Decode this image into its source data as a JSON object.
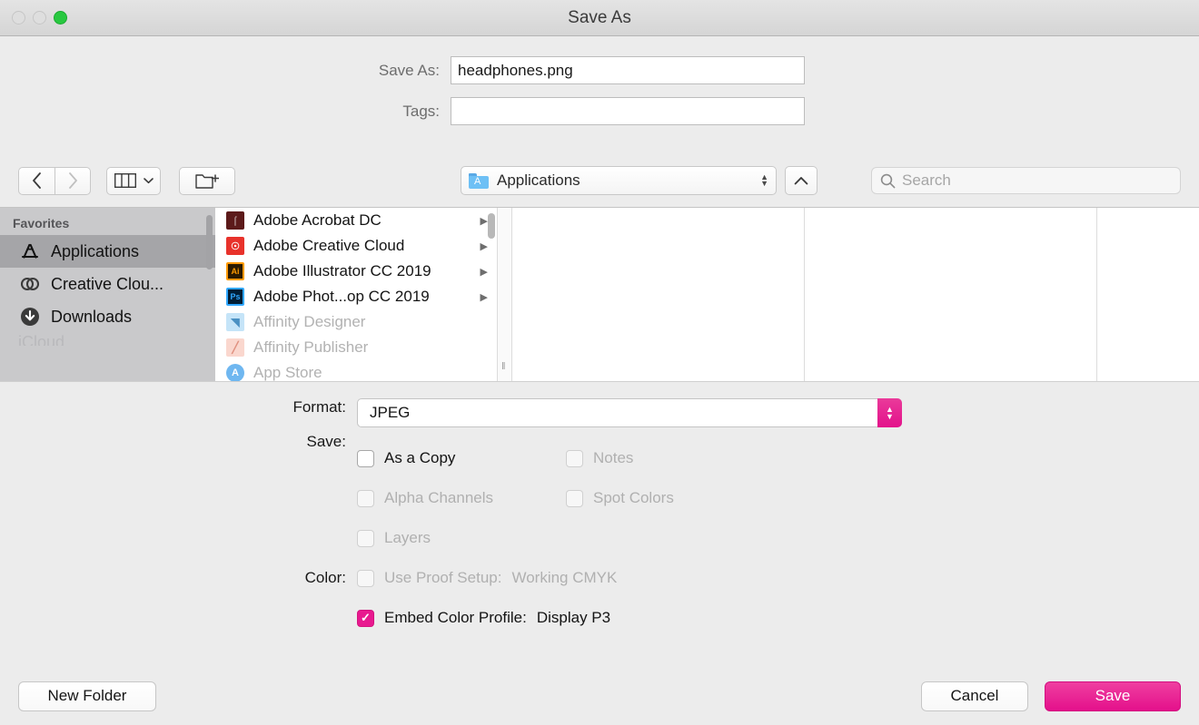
{
  "window": {
    "title": "Save As",
    "traffic_lights": [
      {
        "name": "close",
        "state": "disabled"
      },
      {
        "name": "minimize",
        "state": "disabled"
      },
      {
        "name": "zoom",
        "state": "enabled"
      }
    ]
  },
  "form": {
    "save_as_label": "Save As:",
    "save_as_value": "headphones.png",
    "tags_label": "Tags:",
    "tags_value": "",
    "tags_placeholder": ""
  },
  "toolbar": {
    "back_icon": "chevron-left-icon",
    "forward_icon": "chevron-right-icon",
    "view_icon": "column-view-icon",
    "view_chevron": "chevron-down-icon",
    "new_folder_icon": "new-folder-icon",
    "path_label": "Applications",
    "path_icon": "applications-folder-icon",
    "up_icon": "chevron-up-icon",
    "search_placeholder": "Search",
    "search_value": "",
    "search_icon": "search-icon"
  },
  "sidebar": {
    "header": "Favorites",
    "items": [
      {
        "label": "Applications",
        "icon": "applications-icon",
        "selected": true
      },
      {
        "label": "Creative Clou...",
        "icon": "creative-cloud-icon",
        "selected": false
      },
      {
        "label": "Downloads",
        "icon": "downloads-icon",
        "selected": false
      }
    ],
    "cutoff_label": "iCloud"
  },
  "file_list": [
    {
      "name": "Adobe Acrobat DC",
      "icon": "acrobat-icon",
      "icon_color": "#5c1a1a",
      "glyph": "↯",
      "has_disclosure": true,
      "dimmed": false
    },
    {
      "name": "Adobe Creative Cloud",
      "icon": "creative-cloud-folder-icon",
      "icon_color": "#e8322b",
      "glyph": "∞",
      "has_disclosure": true,
      "dimmed": false
    },
    {
      "name": "Adobe Illustrator CC 2019",
      "icon": "illustrator-icon",
      "icon_color": "#ff9a00",
      "glyph": "Ai",
      "has_disclosure": true,
      "dimmed": false
    },
    {
      "name": "Adobe Phot...op CC 2019",
      "icon": "photoshop-icon",
      "icon_color": "#31a8ff",
      "glyph": "Ps",
      "has_disclosure": true,
      "dimmed": false
    },
    {
      "name": "Affinity Designer",
      "icon": "affinity-designer-icon",
      "icon_color": "#9ed2f5",
      "glyph": "",
      "has_disclosure": false,
      "dimmed": true
    },
    {
      "name": "Affinity Publisher",
      "icon": "affinity-publisher-icon",
      "icon_color": "#f5b3a8",
      "glyph": "",
      "has_disclosure": false,
      "dimmed": true
    },
    {
      "name": "App Store",
      "icon": "app-store-icon",
      "icon_color": "#6fb7f0",
      "glyph": "A",
      "has_disclosure": false,
      "dimmed": true
    }
  ],
  "options": {
    "format_label": "Format:",
    "format_value": "JPEG",
    "save_label": "Save:",
    "color_label": "Color:",
    "checkboxes": {
      "as_a_copy": {
        "label": "As a Copy",
        "checked": false,
        "enabled": true
      },
      "notes": {
        "label": "Notes",
        "checked": false,
        "enabled": false
      },
      "alpha_channels": {
        "label": "Alpha Channels",
        "checked": false,
        "enabled": false
      },
      "spot_colors": {
        "label": "Spot Colors",
        "checked": false,
        "enabled": false
      },
      "layers": {
        "label": "Layers",
        "checked": false,
        "enabled": false
      },
      "use_proof_setup": {
        "label": "Use Proof Setup:",
        "value": "Working CMYK",
        "checked": false,
        "enabled": false
      },
      "embed_color_profile": {
        "label": "Embed Color Profile:",
        "value": "Display P3",
        "checked": true,
        "enabled": true
      }
    },
    "check_mark": "✓"
  },
  "buttons": {
    "new_folder": "New Folder",
    "cancel": "Cancel",
    "save": "Save"
  },
  "colors": {
    "accent": "#e8198f",
    "window_bg": "#ececec",
    "sidebar_bg": "#c9c9cb",
    "selection": "#a5a5a8"
  }
}
